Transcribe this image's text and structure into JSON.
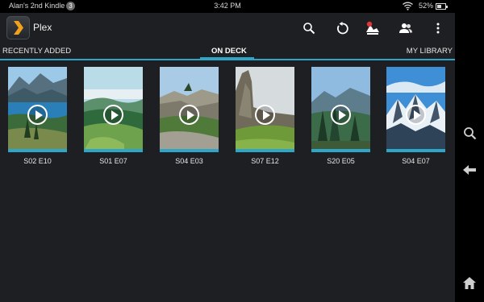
{
  "status_bar": {
    "device_name": "Alan's 2nd Kindle",
    "notification_count": "3",
    "time": "3:42 PM",
    "battery_text": "52%",
    "battery_level": 0.52
  },
  "action_bar": {
    "app_name": "Plex",
    "icons": [
      "search-icon",
      "refresh-icon",
      "cast-icon",
      "users-icon",
      "overflow-menu-icon"
    ]
  },
  "tabs": [
    {
      "label": "RECENTLY ADDED",
      "active": false
    },
    {
      "label": "ON DECK",
      "active": true
    },
    {
      "label": "MY LIBRARY",
      "active": false
    }
  ],
  "on_deck": [
    {
      "episode": "S02 E10",
      "progress": 1.0,
      "scene": "lake-mountains"
    },
    {
      "episode": "S01 E07",
      "progress": 1.0,
      "scene": "green-valley"
    },
    {
      "episode": "S04 E03",
      "progress": 1.0,
      "scene": "rocky-cliff"
    },
    {
      "episode": "S07 E12",
      "progress": 1.0,
      "scene": "rock-pinnacle"
    },
    {
      "episode": "S20 E05",
      "progress": 1.0,
      "scene": "pine-forest"
    },
    {
      "episode": "S04 E07",
      "progress": 1.0,
      "scene": "snowy-peaks"
    }
  ],
  "nav_bar": {
    "icons": [
      "search-icon",
      "back-icon",
      "home-icon"
    ]
  },
  "colors": {
    "accent": "#2fa5c8",
    "background": "#1e1f22",
    "plex_orange": "#f0a21a"
  }
}
